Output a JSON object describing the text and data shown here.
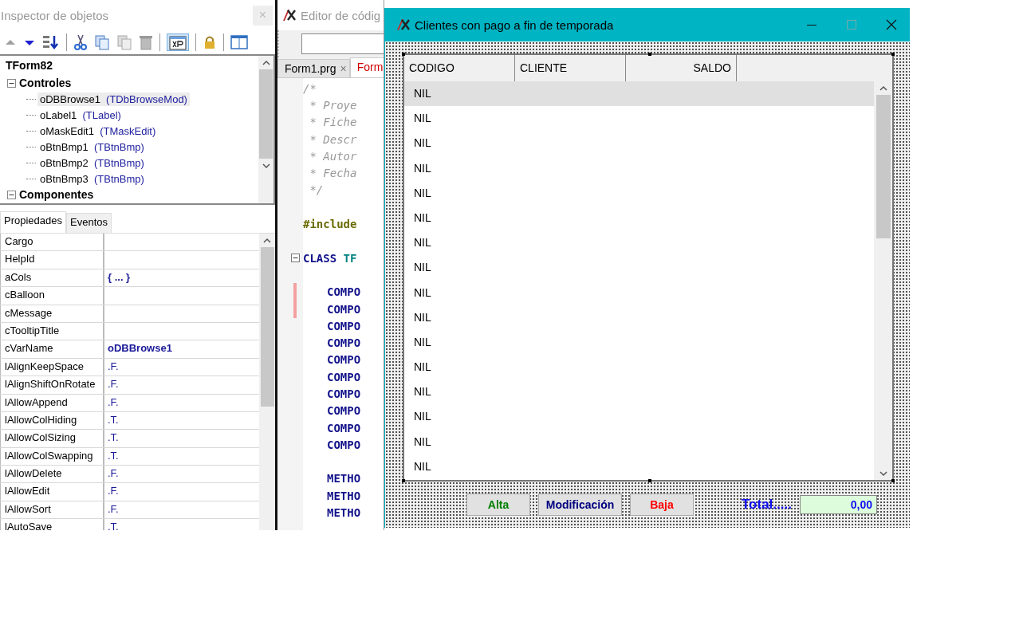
{
  "inspector": {
    "title": "Inspector de objetos",
    "close": "×",
    "tree": {
      "label": "TForm82",
      "children": [
        {
          "label": "Controles",
          "expanded": true,
          "children": [
            {
              "name": "oDBBrowse1",
              "class": "(TDbBrowseMod)",
              "selected": true
            },
            {
              "name": "oLabel1",
              "class": "(TLabel)",
              "selected": false
            },
            {
              "name": "oMaskEdit1",
              "class": "(TMaskEdit)",
              "selected": false
            },
            {
              "name": "oBtnBmp1",
              "class": "(TBtnBmp)",
              "selected": false
            },
            {
              "name": "oBtnBmp2",
              "class": "(TBtnBmp)",
              "selected": false
            },
            {
              "name": "oBtnBmp3",
              "class": "(TBtnBmp)",
              "selected": false
            }
          ]
        },
        {
          "label": "Componentes",
          "expanded": true
        }
      ]
    },
    "tabs": [
      {
        "label": "Propiedades",
        "selected": true
      },
      {
        "label": "Eventos",
        "selected": false
      }
    ],
    "properties": [
      {
        "name": "Cargo"
      },
      {
        "name": "HelpId"
      },
      {
        "name": "aCols",
        "value": "{ ... }",
        "bold": true
      },
      {
        "name": "cBalloon"
      },
      {
        "name": "cMessage"
      },
      {
        "name": "cTooltipTitle"
      },
      {
        "name": "cVarName",
        "value": "oDBBrowse1",
        "bold": true
      },
      {
        "name": "lAlignKeepSpace",
        "value": ".F.",
        "bold": false
      },
      {
        "name": "lAlignShiftOnRotate",
        "value": ".F.",
        "bold": false
      },
      {
        "name": "lAllowAppend",
        "value": ".F.",
        "bold": false
      },
      {
        "name": "lAllowColHiding",
        "value": ".T.",
        "bold": false
      },
      {
        "name": "lAllowColSizing",
        "value": ".T.",
        "bold": false
      },
      {
        "name": "lAllowColSwapping",
        "value": ".T.",
        "bold": false
      },
      {
        "name": "lAllowDelete",
        "value": ".F.",
        "bold": false
      },
      {
        "name": "lAllowEdit",
        "value": ".F.",
        "bold": false
      },
      {
        "name": "lAllowSort",
        "value": ".F.",
        "bold": false
      },
      {
        "name": "lAutoSave",
        "value": ".T.",
        "bold": false
      }
    ]
  },
  "editor": {
    "title": "Editor de códig",
    "tabs": [
      {
        "label": "Form1.prg",
        "selected": false,
        "close": "×"
      },
      {
        "label": "Form",
        "selected": true
      }
    ],
    "lines": [
      {
        "kind": "comment",
        "text": "/*",
        "marked": false
      },
      {
        "kind": "comment",
        "text": " * Proye",
        "marked": false
      },
      {
        "kind": "comment",
        "text": " * Fiche",
        "marked": false
      },
      {
        "kind": "comment",
        "text": " * Descr",
        "marked": false
      },
      {
        "kind": "comment",
        "text": " * Autor",
        "marked": false
      },
      {
        "kind": "comment",
        "text": " * Fecha",
        "marked": false
      },
      {
        "kind": "comment",
        "text": " */",
        "marked": false
      },
      {
        "kind": "blank",
        "marked": false
      },
      {
        "kind": "directive",
        "text": "#include",
        "marked": false
      },
      {
        "kind": "blank",
        "marked": false
      },
      {
        "kind": "class",
        "text": "CLASS",
        "name": "TF",
        "marked": false
      },
      {
        "kind": "blank",
        "marked": false
      },
      {
        "kind": "member",
        "text": "COMPO",
        "marked": true
      },
      {
        "kind": "member",
        "text": "COMPO",
        "marked": true
      },
      {
        "kind": "member",
        "text": "COMPO",
        "marked": false
      },
      {
        "kind": "member",
        "text": "COMPO",
        "marked": false
      },
      {
        "kind": "member",
        "text": "COMPO",
        "marked": false
      },
      {
        "kind": "member",
        "text": "COMPO",
        "marked": false
      },
      {
        "kind": "member",
        "text": "COMPO",
        "marked": false
      },
      {
        "kind": "member",
        "text": "COMPO",
        "marked": false
      },
      {
        "kind": "member",
        "text": "COMPO",
        "marked": false
      },
      {
        "kind": "member",
        "text": "COMPO",
        "marked": false
      },
      {
        "kind": "blank",
        "marked": false
      },
      {
        "kind": "member",
        "text": "METHO",
        "marked": false
      },
      {
        "kind": "member",
        "text": "METHO",
        "marked": false
      },
      {
        "kind": "member",
        "text": "METHO",
        "marked": false
      }
    ]
  },
  "form": {
    "title": "Clientes con pago a fin de temporada",
    "columns": [
      {
        "label": "CODIGO"
      },
      {
        "label": "CLIENTE"
      },
      {
        "label": "SALDO"
      }
    ],
    "rows": [
      {
        "codigo": "NIL",
        "selected": true
      },
      {
        "codigo": "NIL",
        "selected": false
      },
      {
        "codigo": "NIL",
        "selected": false
      },
      {
        "codigo": "NIL",
        "selected": false
      },
      {
        "codigo": "NIL",
        "selected": false
      },
      {
        "codigo": "NIL",
        "selected": false
      },
      {
        "codigo": "NIL",
        "selected": false
      },
      {
        "codigo": "NIL",
        "selected": false
      },
      {
        "codigo": "NIL",
        "selected": false
      },
      {
        "codigo": "NIL",
        "selected": false
      },
      {
        "codigo": "NIL",
        "selected": false
      },
      {
        "codigo": "NIL",
        "selected": false
      },
      {
        "codigo": "NIL",
        "selected": false
      },
      {
        "codigo": "NIL",
        "selected": false
      },
      {
        "codigo": "NIL",
        "selected": false
      },
      {
        "codigo": "NIL",
        "selected": false
      }
    ],
    "buttons": [
      {
        "label": "Alta",
        "color": "#008000"
      },
      {
        "label": "Modificación",
        "color": "#000080"
      },
      {
        "label": "Baja",
        "color": "#ff0000"
      }
    ],
    "total_label": "Total.....",
    "total_value": "0,00"
  }
}
